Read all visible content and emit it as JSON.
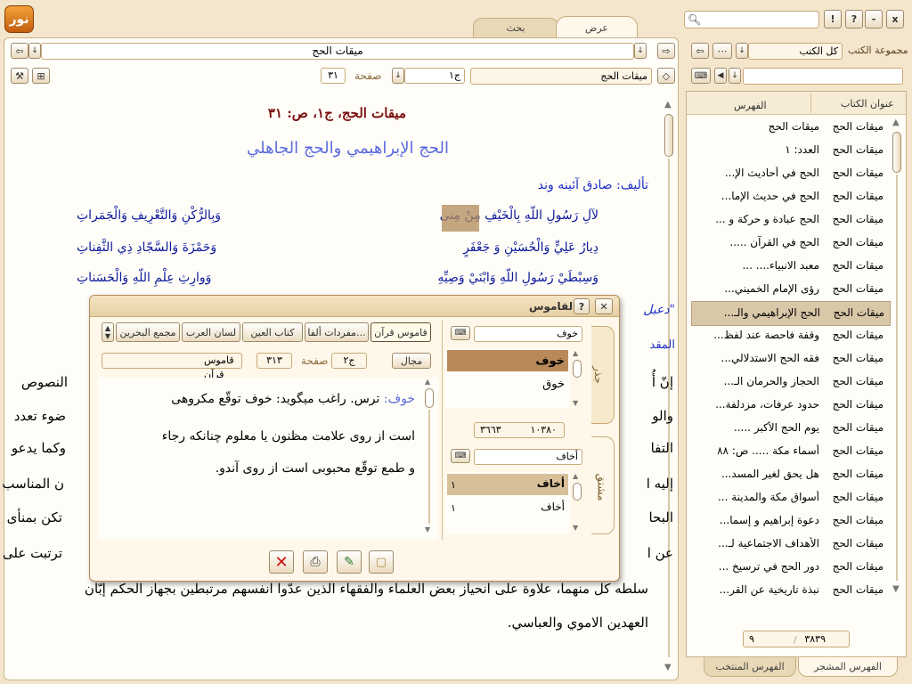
{
  "top": {
    "tabs": [
      "عرض",
      "بحث"
    ],
    "search_placeholder": "",
    "window_buttons": [
      "!",
      "?",
      "-",
      "x"
    ],
    "collection_label": "مجموعة الكتب",
    "collection_value": "كل الكتب"
  },
  "reader": {
    "title": "ميقات الحج",
    "page_label": "صفحة",
    "page_value": "٣١",
    "volume_value": "ج١",
    "book_field": "ميقات الحج",
    "heading": "ميقات الحج، ج١، ص: ٣١",
    "chapter_title": "الحج الإبراهيمي والحج الجاهلي",
    "author": "تأليف: صادق آئينه وند",
    "poem": [
      {
        "right": "لآلِ رَسُولِ اللّهِ بِالْخَيْفِ مِنْ مِنى",
        "left": "وَبِالرُّكْنِ وَالتَّعْرِيفِ وَالْجَمَراتِ"
      },
      {
        "right": "دِيارُ عَلِيٍّ وَالْحُسَيْنِ وَ جَعْفَرٍ",
        "left": "وَحَمْزَةَ وَالسَّجّادِ ذِي الثَّفِناتِ"
      },
      {
        "right": "وَسِبْطَيْ رَسُولِ اللّهِ وَابْنَيْ وَصِيِّهِ",
        "left": "وَوارِثِ عِلْمِ اللّهِ وَالْحَسَناتِ"
      }
    ],
    "highlight_word": "خَيْف",
    "partial_lines": [
      "\"دعبل",
      "المقد",
      "إنّ أُ",
      "والو",
      "التفا",
      "إليه ا",
      "البحا",
      "عن ا"
    ],
    "partial_right_ends": [
      "النصوص",
      "ضوء تعدد",
      "وكما يدعو",
      "ن المناسب",
      "تكن بمنأى",
      "ترتبت على"
    ],
    "body_lines": [
      "سلطه كل منهما، علاوة على انحياز بعض العلماء والفقهاء الذين عدّوا انفسهم مرتبطين بجهاز الحكم إبّان",
      "العهدين الاموي والعباسي."
    ]
  },
  "dictionary": {
    "title": "القاموس",
    "dict_tabs": [
      "قاموس قرآن",
      "مفردات ألفا...",
      "كتاب العين",
      "لسان العرب",
      "مجمع البحرين"
    ],
    "field_label": "مجال",
    "field_value": "قاموس قرآن",
    "page_label": "صفحة",
    "page_value": "٣١٣",
    "volume_value": "ج٢",
    "root_input": "خوف",
    "root_items": [
      "خوف",
      "خوق"
    ],
    "root_counts": [
      "١٠٣٨٠",
      "٣٦٦٣"
    ],
    "derived_input": "أخاف",
    "derived_items": [
      {
        "word": "أخاف",
        "count": "١"
      },
      {
        "word": "أخاف",
        "count": "١"
      }
    ],
    "side_tabs": [
      "جذر",
      "مشتق"
    ],
    "definition_head": "خوف:",
    "definition_lines": [
      "ترس. راغب ميگويد: خوف توقّع مكروهى",
      "است از روى علامت مظنون يا معلوم چنانكه رجاء",
      "و طمع توقّع محبوبى است از روى آندو."
    ]
  },
  "toc": {
    "col_book": "عنوان الكتاب",
    "col_index": "الفهرس",
    "rows": [
      {
        "book": "ميقات الحج",
        "title": "ميقات الحج"
      },
      {
        "book": "ميقات الحج",
        "title": "العدد: ١"
      },
      {
        "book": "ميقات الحج",
        "title": "الحج في أحاديث الإ..."
      },
      {
        "book": "ميقات الحج",
        "title": "الحج في حديث الإما..."
      },
      {
        "book": "ميقات الحج",
        "title": "الحج عبادة و حركة و ..."
      },
      {
        "book": "ميقات الحج",
        "title": "الحج في القرآن ....."
      },
      {
        "book": "ميقات الحج",
        "title": "معبد الانبياء.... ..."
      },
      {
        "book": "ميقات الحج",
        "title": "رؤى الإمام الخميني..."
      },
      {
        "book": "ميقات الحج",
        "title": "الحج الإبراهيمي والـ..."
      },
      {
        "book": "ميقات الحج",
        "title": "وقفة فاحصة عند لفظ..."
      },
      {
        "book": "ميقات الحج",
        "title": "فقه الحج الاستدلالي..."
      },
      {
        "book": "ميقات الحج",
        "title": "الحجاز والحرمان الـ..."
      },
      {
        "book": "ميقات الحج",
        "title": "حدود عرفات، مزدلفة..."
      },
      {
        "book": "ميقات الحج",
        "title": "يوم الحج الأكبر ....."
      },
      {
        "book": "ميقات الحج",
        "title": "أسماء مكة ..... ص: ٨٨"
      },
      {
        "book": "ميقات الحج",
        "title": "هل يحق لغير المسد..."
      },
      {
        "book": "ميقات الحج",
        "title": "أسواق مكة والمدينة ..."
      },
      {
        "book": "ميقات الحج",
        "title": "دعوة إبراهيم و إسما..."
      },
      {
        "book": "ميقات الحج",
        "title": "الأهداف الاجتماعية لـ..."
      },
      {
        "book": "ميقات الحج",
        "title": "دور الحج في ترسيخ ..."
      },
      {
        "book": "ميقات الحج",
        "title": "نبذة تاريخية عن القر..."
      }
    ],
    "selected_index": 8,
    "count_total": "٣٨٣٩",
    "count_current": "٩",
    "bottom_tabs": [
      "الفهرس المشجر",
      "الفهرس المنتخب"
    ]
  },
  "colors": {
    "accent": "#c8923a",
    "heading": "#7a1010",
    "chapter": "#5a6ae0",
    "highlight": "#b08a58"
  }
}
